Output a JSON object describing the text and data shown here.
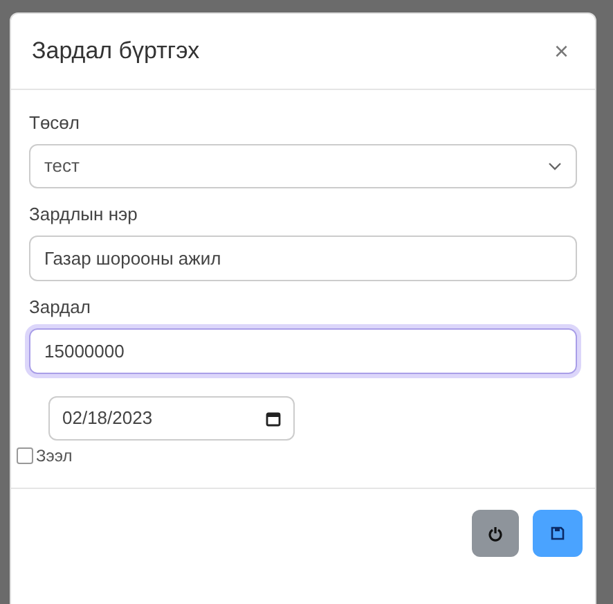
{
  "modal": {
    "title": "Зардал бүртгэх",
    "close": "×"
  },
  "fields": [
    {
      "kind": "select",
      "label": "Төсөл",
      "value": "тест",
      "focused": false
    },
    {
      "kind": "text",
      "label": "Зардлын нэр",
      "value": "Газар шорооны ажил",
      "focused": false
    },
    {
      "kind": "text",
      "label": "Зардал",
      "value": "15000000",
      "focused": true
    }
  ],
  "date": {
    "value": "02/18/2023"
  },
  "loan": {
    "label": "Зээл",
    "checked": false
  },
  "buttons": [
    {
      "kind": "power"
    },
    {
      "kind": "save"
    }
  ]
}
